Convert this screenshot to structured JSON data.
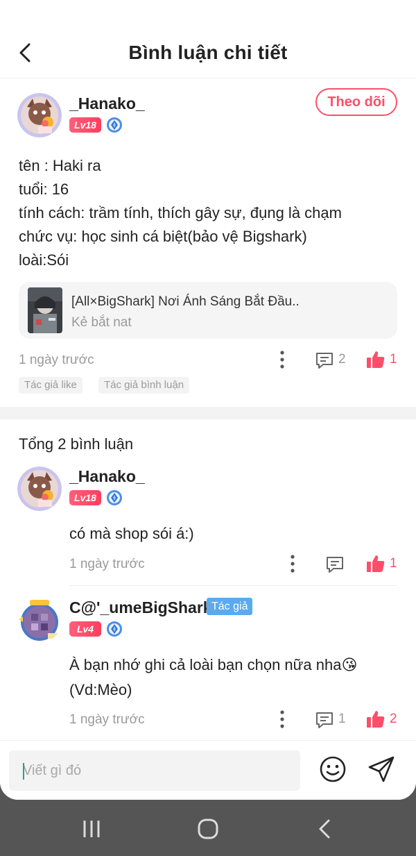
{
  "header": {
    "title": "Bình luận chi tiết"
  },
  "main_comment": {
    "username": "_Hanako_",
    "level": "Lv18",
    "follow_label": "Theo dõi",
    "text": "tên : Haki ra\ntuổi: 16\ntính cách: trầm tính, thích gây sự, đụng là chạm\nchức vụ: học sinh cá biệt(bảo vệ Bigshark)\nloài:Sói",
    "story": {
      "title": "[All×BigShark] Nơi Ánh Sáng Bắt Đầu..",
      "author": "Kẻ bắt nat"
    },
    "time": "1 ngày trước",
    "comment_count": "2",
    "like_count": "1",
    "tags": [
      "Tác giả like",
      "Tác giả bình luận"
    ]
  },
  "replies_section": {
    "total_label": "Tổng 2 bình luận"
  },
  "replies": [
    {
      "username": "_Hanako_",
      "level": "Lv18",
      "text": "có mà shop sói á:)",
      "time": "1 ngày trước",
      "like_count": "1"
    },
    {
      "username": "C@'_umeBigShark",
      "author_tag": "Tác giả",
      "level": "Lv4",
      "text": "À bạn nhớ ghi cả loài bạn chọn nữa nha😘\n(Vd:Mèo)",
      "time": "1 ngày trước",
      "comment_count": "1",
      "like_count": "2"
    }
  ],
  "input": {
    "placeholder": "Viết gì đó"
  },
  "colors": {
    "accent": "#ff4d6a",
    "author_tag": "#5aaaf0",
    "muted_text": "#9a9a9a",
    "navbar": "#555555"
  },
  "icons": {
    "back": "chevron-left-icon",
    "more": "more-vertical-icon",
    "comment": "comment-icon",
    "like": "thumbs-up-icon",
    "emoji": "smiley-icon",
    "send": "send-icon",
    "level_gem": "diamond-icon"
  }
}
